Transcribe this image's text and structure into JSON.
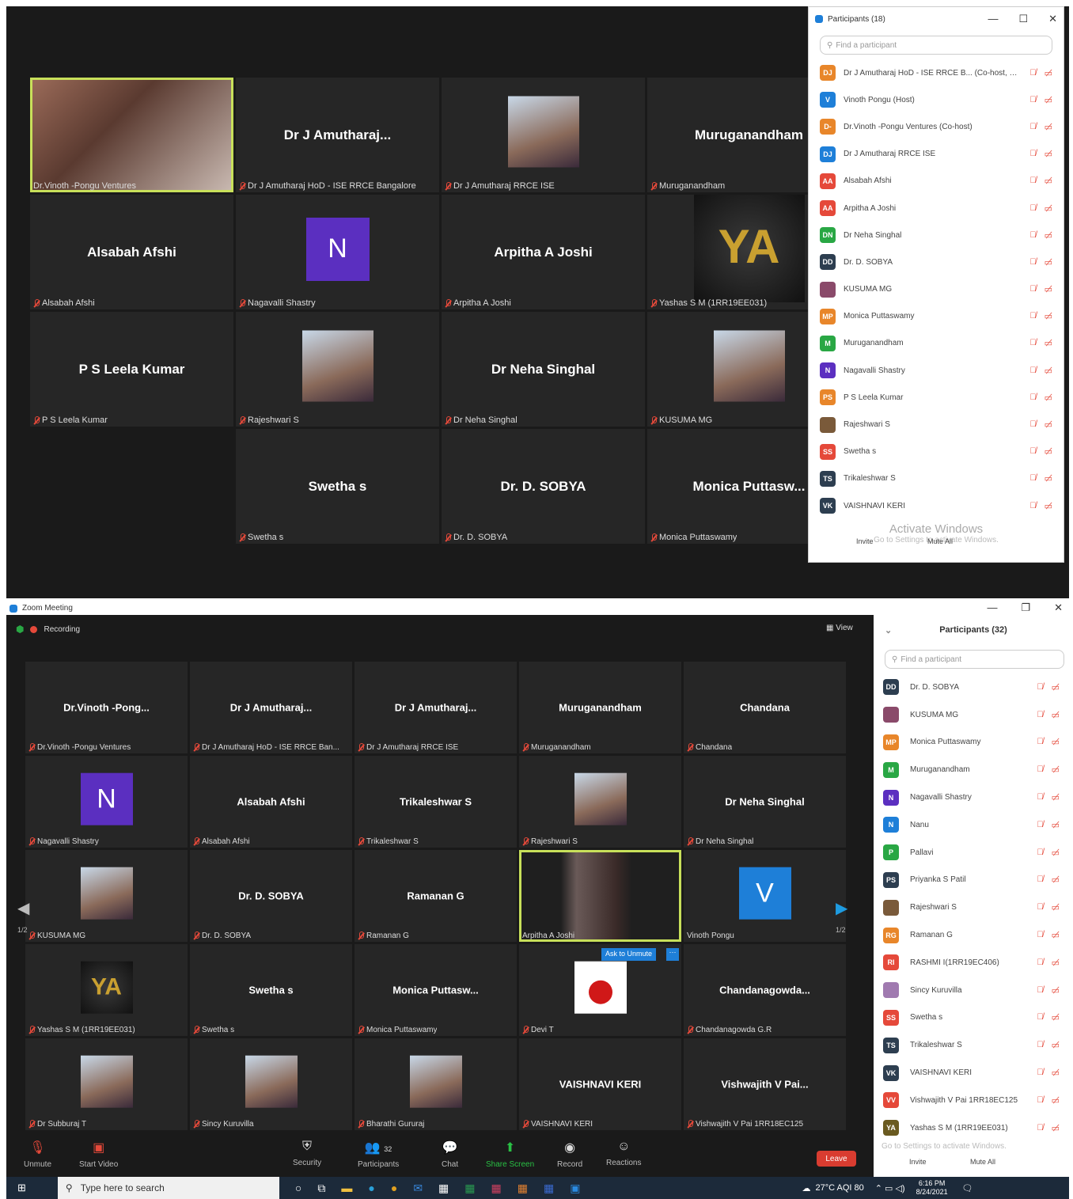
{
  "top": {
    "title": "Participants (18)",
    "search_placeholder": "Find a participant",
    "tiles": [
      {
        "name": "",
        "label": "Dr.Vinoth -Pongu Ventures",
        "type": "video",
        "active": true
      },
      {
        "name": "Dr J Amutharaj...",
        "label": "Dr J Amutharaj HoD - ISE RRCE Bangalore",
        "type": "name"
      },
      {
        "name": "",
        "label": "Dr J Amutharaj RRCE ISE",
        "type": "photo"
      },
      {
        "name": "Muruganandham",
        "label": "Muruganandham",
        "type": "name"
      },
      {
        "name": "Alsabah Afshi",
        "label": "Alsabah Afshi",
        "type": "name"
      },
      {
        "name": "",
        "label": "Nagavalli Shastry",
        "type": "avatar",
        "avatar": "N",
        "color": "#5b2fc0"
      },
      {
        "name": "Arpitha A Joshi",
        "label": "Arpitha A Joshi",
        "type": "name"
      },
      {
        "name": "",
        "label": "Yashas S M (1RR19EE031)",
        "type": "ya"
      },
      {
        "name": "P S Leela Kumar",
        "label": "P S Leela Kumar",
        "type": "name"
      },
      {
        "name": "",
        "label": "Rajeshwari S",
        "type": "photo"
      },
      {
        "name": "Dr Neha Singhal",
        "label": "Dr Neha Singhal",
        "type": "name"
      },
      {
        "name": "",
        "label": "KUSUMA MG",
        "type": "photo"
      },
      {
        "name": "",
        "label": "",
        "type": "empty"
      },
      {
        "name": "Swetha s",
        "label": "Swetha s",
        "type": "name"
      },
      {
        "name": "Dr. D. SOBYA",
        "label": "Dr. D. SOBYA",
        "type": "name"
      },
      {
        "name": "Monica Puttasw...",
        "label": "Monica Puttaswamy",
        "type": "name"
      }
    ],
    "participants": [
      {
        "av": "DJ",
        "c": "#e8862a",
        "name": "Dr J Amutharaj HoD - ISE RRCE B... (Co-host, me)"
      },
      {
        "av": "V",
        "c": "#1e7fd8",
        "name": "Vinoth Pongu (Host)"
      },
      {
        "av": "D-",
        "c": "#e8862a",
        "name": "Dr.Vinoth -Pongu Ventures (Co-host)"
      },
      {
        "av": "DJ",
        "c": "#1e7fd8",
        "name": "Dr J Amutharaj RRCE ISE"
      },
      {
        "av": "AA",
        "c": "#e5493a",
        "name": "Alsabah Afshi"
      },
      {
        "av": "AA",
        "c": "#e5493a",
        "name": "Arpitha A Joshi"
      },
      {
        "av": "DN",
        "c": "#29a744",
        "name": "Dr Neha Singhal"
      },
      {
        "av": "DD",
        "c": "#2d3e50",
        "name": "Dr. D. SOBYA"
      },
      {
        "av": "",
        "c": "#8a4a6a",
        "name": "KUSUMA MG"
      },
      {
        "av": "MP",
        "c": "#e8862a",
        "name": "Monica Puttaswamy"
      },
      {
        "av": "M",
        "c": "#29a744",
        "name": "Muruganandham"
      },
      {
        "av": "N",
        "c": "#5b2fc0",
        "name": "Nagavalli Shastry"
      },
      {
        "av": "PS",
        "c": "#e8862a",
        "name": "P S Leela Kumar"
      },
      {
        "av": "",
        "c": "#7a5a3a",
        "name": "Rajeshwari S"
      },
      {
        "av": "SS",
        "c": "#e5493a",
        "name": "Swetha s"
      },
      {
        "av": "TS",
        "c": "#2d3e50",
        "name": "Trikaleshwar S"
      },
      {
        "av": "VK",
        "c": "#2d3e50",
        "name": "VAISHNAVI KERI"
      }
    ],
    "activate": "Activate Windows",
    "activate_sub": "Go to Settings to activate Windows.",
    "invite": "Invite",
    "mute_all": "Mute All"
  },
  "bottom": {
    "window_title": "Zoom Meeting",
    "recording": "Recording",
    "view": "View",
    "panel_title": "Participants (32)",
    "search_placeholder": "Find a participant",
    "page_left": "1/2",
    "page_right": "1/2",
    "ask_unmute": "Ask to Unmute",
    "tiles": [
      {
        "name": "Dr.Vinoth -Pong...",
        "label": "Dr.Vinoth -Pongu Ventures",
        "type": "name"
      },
      {
        "name": "Dr J Amutharaj...",
        "label": "Dr J Amutharaj HoD - ISE RRCE Ban...",
        "type": "name"
      },
      {
        "name": "Dr J Amutharaj...",
        "label": "Dr J Amutharaj RRCE ISE",
        "type": "name"
      },
      {
        "name": "Muruganandham",
        "label": "Muruganandham",
        "type": "name"
      },
      {
        "name": "Chandana",
        "label": "Chandana",
        "type": "name"
      },
      {
        "name": "",
        "label": "Nagavalli Shastry",
        "type": "avatar",
        "avatar": "N",
        "color": "#5b2fc0"
      },
      {
        "name": "Alsabah Afshi",
        "label": "Alsabah Afshi",
        "type": "name"
      },
      {
        "name": "Trikaleshwar S",
        "label": "Trikaleshwar S",
        "type": "name"
      },
      {
        "name": "",
        "label": "Rajeshwari S",
        "type": "photo"
      },
      {
        "name": "Dr Neha Singhal",
        "label": "Dr Neha Singhal",
        "type": "name"
      },
      {
        "name": "",
        "label": "KUSUMA MG",
        "type": "photo"
      },
      {
        "name": "Dr. D. SOBYA",
        "label": "Dr. D. SOBYA",
        "type": "name"
      },
      {
        "name": "Ramanan G",
        "label": "Ramanan G",
        "type": "name"
      },
      {
        "name": "",
        "label": "Arpitha A Joshi",
        "type": "video",
        "active": true
      },
      {
        "name": "",
        "label": "Vinoth Pongu",
        "type": "avatar",
        "avatar": "V",
        "color": "#1e7fd8",
        "nomic": true
      },
      {
        "name": "",
        "label": "Yashas S M (1RR19EE031)",
        "type": "ya"
      },
      {
        "name": "Swetha s",
        "label": "Swetha s",
        "type": "name"
      },
      {
        "name": "Monica Puttasw...",
        "label": "Monica Puttaswamy",
        "type": "name"
      },
      {
        "name": "",
        "label": "Devi T",
        "type": "rose"
      },
      {
        "name": "Chandanagowda...",
        "label": "Chandanagowda G.R",
        "type": "name"
      },
      {
        "name": "",
        "label": "Dr Subburaj T",
        "type": "photo"
      },
      {
        "name": "",
        "label": "Sincy Kuruvilla",
        "type": "photo"
      },
      {
        "name": "",
        "label": "Bharathi Gururaj",
        "type": "photo"
      },
      {
        "name": "VAISHNAVI KERI",
        "label": "VAISHNAVI KERI",
        "type": "name"
      },
      {
        "name": "Vishwajith V Pai...",
        "label": "Vishwajith V Pai 1RR18EC125",
        "type": "name"
      }
    ],
    "participants": [
      {
        "av": "DD",
        "c": "#2d3e50",
        "name": "Dr. D. SOBYA"
      },
      {
        "av": "",
        "c": "#8a4a6a",
        "name": "KUSUMA MG"
      },
      {
        "av": "MP",
        "c": "#e8862a",
        "name": "Monica Puttaswamy"
      },
      {
        "av": "M",
        "c": "#29a744",
        "name": "Muruganandham"
      },
      {
        "av": "N",
        "c": "#5b2fc0",
        "name": "Nagavalli Shastry"
      },
      {
        "av": "N",
        "c": "#1e7fd8",
        "name": "Nanu"
      },
      {
        "av": "P",
        "c": "#29a744",
        "name": "Pallavi"
      },
      {
        "av": "PS",
        "c": "#2d3e50",
        "name": "Priyanka S Patil"
      },
      {
        "av": "",
        "c": "#7a5a3a",
        "name": "Rajeshwari S"
      },
      {
        "av": "RG",
        "c": "#e8862a",
        "name": "Ramanan G"
      },
      {
        "av": "RI",
        "c": "#e5493a",
        "name": "RASHMI I(1RR19EC406)"
      },
      {
        "av": "",
        "c": "#a07ab0",
        "name": "Sincy Kuruvilla"
      },
      {
        "av": "SS",
        "c": "#e5493a",
        "name": "Swetha s"
      },
      {
        "av": "TS",
        "c": "#2d3e50",
        "name": "Trikaleshwar S"
      },
      {
        "av": "VK",
        "c": "#2d3e50",
        "name": "VAISHNAVI KERI"
      },
      {
        "av": "VV",
        "c": "#e5493a",
        "name": "Vishwajith V Pai 1RR18EC125"
      },
      {
        "av": "YA",
        "c": "#6a5a20",
        "name": "Yashas S M (1RR19EE031)"
      }
    ],
    "activate_sub": "Go to Settings to activate Windows.",
    "invite": "Invite",
    "mute_all": "Mute All",
    "toolbar": {
      "unmute": "Unmute",
      "start_video": "Start Video",
      "security": "Security",
      "participants": "Participants",
      "participants_count": "32",
      "chat": "Chat",
      "share": "Share Screen",
      "record": "Record",
      "reactions": "Reactions",
      "leave": "Leave"
    }
  },
  "taskbar": {
    "search": "Type here to search",
    "weather": "27°C AQI 80",
    "time": "6:16 PM",
    "date": "8/24/2021"
  }
}
